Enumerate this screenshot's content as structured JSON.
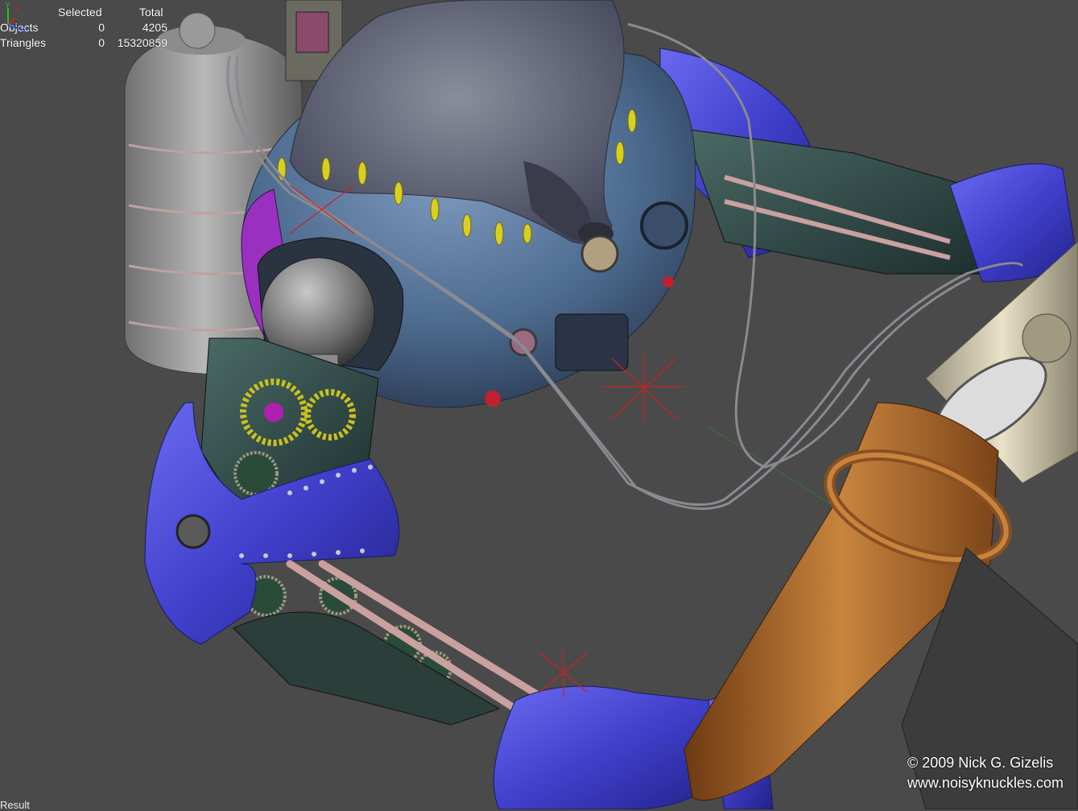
{
  "stats": {
    "header_selected": "Selected",
    "header_total": "Total",
    "rows": [
      {
        "label": "Objects",
        "selected": "0",
        "total": "4205"
      },
      {
        "label": "Triangles",
        "selected": "0",
        "total": "15320859"
      }
    ]
  },
  "axis": {
    "y": "Y",
    "x": "X",
    "z": "Z"
  },
  "copyright": {
    "line1": "© 2009 Nick G. Gizelis",
    "line2": "www.noisyknuckles.com"
  },
  "status": {
    "label": "Result"
  },
  "colors": {
    "background": "#4a4a4a",
    "armor_blue": "#4a4ad8",
    "body_blue": "#4d6b8f",
    "copper": "#b8722e",
    "fur_gray": "#6c7180",
    "gear_yellow": "#c8c020",
    "marker_red": "#d02020"
  }
}
